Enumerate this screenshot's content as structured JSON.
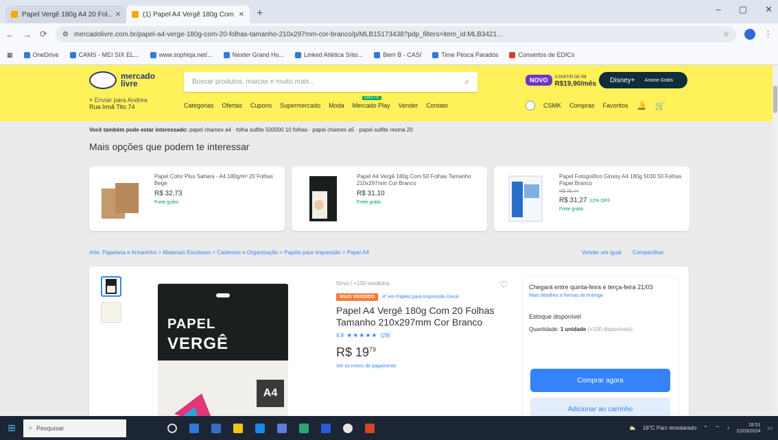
{
  "browser": {
    "tabs": [
      {
        "title": "Papel Vergê 180g A4 20 Fol...",
        "active": false
      },
      {
        "title": "(1) Papel A4 Vergê 180g Com...",
        "active": true
      }
    ],
    "new_tab": "+",
    "window_buttons": {
      "minimize": "–",
      "maximize": "▢",
      "close": "✕"
    },
    "nav": {
      "back": "←",
      "forward": "→",
      "reload": "⟳"
    },
    "url": "mercadolivre.com.br/papel-a4-verge-180g-com-20-folhas-tamanho-210x297mm-cor-branco/p/MLB15173438?pdp_filters=item_id:MLB3421...",
    "bookmarks": [
      "OneDrive",
      "CAMS - MEI SIX EL...",
      "www.sophiqa.net/...",
      "Nexter Grand Ho...",
      "Linked Atlética Sítio...",
      "Bem B - CASI",
      "Time Pesca Parados",
      "Consertos de EDICs"
    ]
  },
  "header": {
    "logo_line1": "mercado",
    "logo_line2": "livre",
    "search_placeholder": "Buscar produtos, marcas e muito mais...",
    "promo_badge": "NOVO",
    "promo_price_label": "A PARTIR DE R$",
    "promo_price": "R$19,90/mês",
    "promo_brand": "Disney+",
    "promo_cta": "Assine Grátis",
    "location_line1": "Enviar para Andrea",
    "location_line2": "Rua Irmã Tito 74",
    "nav_items": [
      "Categorias",
      "Ofertas",
      "Cupons",
      "Supermercado",
      "Moda",
      "Mercado Play",
      "Vender",
      "Contato"
    ],
    "mercado_play_tag": "GRÁTIS",
    "user_name": "CSMK",
    "user_links": [
      "Compras",
      "Favoritos"
    ]
  },
  "content": {
    "related_label": "Você também pode estar interessado:",
    "related_links": "papel chamex a4 · folha sulfite 500000 10 folhas · papel chamex a5 · papel sulfite resma 20",
    "section_title": "Mais opções que podem te interessar",
    "cards": [
      {
        "title": "Papel Color Plus Sahara - A4 180g/m² 20 Folhas Bege",
        "old_price": "",
        "price": "R$ 32,73",
        "off": "",
        "shipping": "Frete grátis"
      },
      {
        "title": "Papel A4 Vergê 180g Com 50 Folhas Tamanho 210x297mm Cor Branco",
        "old_price": "",
        "price": "R$ 31,10",
        "off": "",
        "shipping": "Frete grátis"
      },
      {
        "title": "Papel Fotográfico Glossy A4 180g 5030 50 Folhas Papel Branco",
        "old_price": "R$ 35,44",
        "price": "R$ 31,27",
        "off": "12% OFF",
        "shipping": "Frete grátis"
      }
    ],
    "breadcrumb": "Arte, Papelaria e Armarinho > Materiais Escolares > Cadernos e Organização > Papéis para Impressão > Papel A4",
    "bc_sell": "Vender um igual",
    "bc_share": "Compartilhar",
    "product": {
      "image_line1": "PAPEL",
      "image_line2": "VERGÊ",
      "image_badge": "A4",
      "condition": "Novo | +100 vendidos",
      "best_seller": "MAIS VENDIDO",
      "best_seller_rank": "4º em Papéis para Impressão Geral",
      "title": "Papel A4 Vergê 180g Com 20 Folhas Tamanho 210x297mm Cor Branco",
      "rating_value": "4.8",
      "stars": "★★★★★",
      "rating_count": "(29)",
      "price_main": "R$ 19",
      "price_cents": "79",
      "installments": "Ver os meios de pagamento",
      "arrival": "Chegará entre quinta-feira e terça-feira 21/03",
      "more_options": "Mais detalhes e formas de entrega",
      "stock": "Estoque disponível",
      "qty_label": "Quantidade:",
      "qty_value": "1 unidade",
      "qty_available": "(+100 disponíveis)",
      "buy_now": "Comprar agora",
      "add_cart": "Adicionar ao carrinho"
    }
  },
  "taskbar": {
    "search_placeholder": "Pesquisar",
    "weather": "16°C Parc ensolarado",
    "time": "18:51",
    "date": "22/03/2024"
  }
}
